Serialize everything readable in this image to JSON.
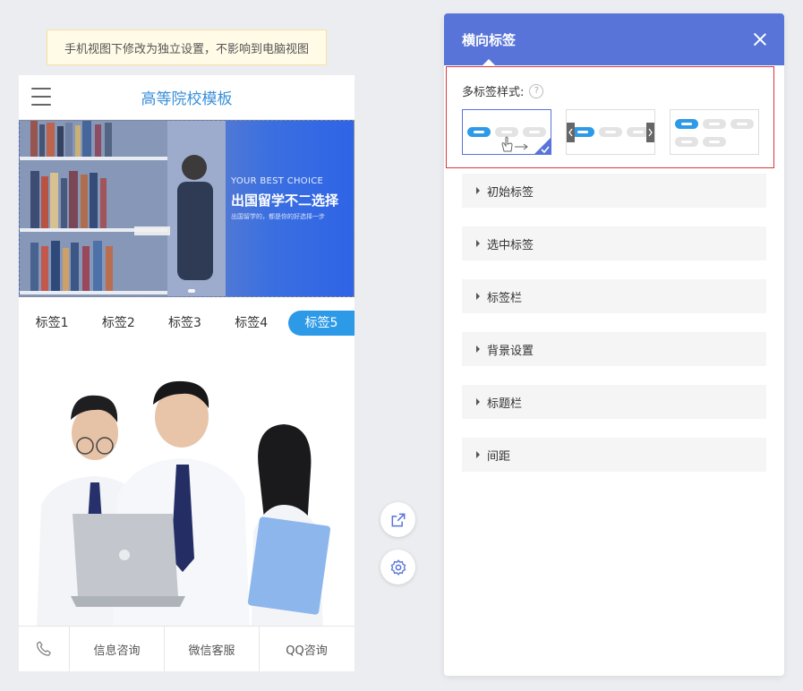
{
  "notice": "手机视图下修改为独立设置，不影响到电脑视图",
  "phone": {
    "title": "高等院校模板",
    "banner": {
      "eng": "YOUR BEST CHOICE",
      "big": "出国留学不二选择",
      "small": "出国留学的，都是你的好选择一步"
    },
    "tabs": [
      "标签1",
      "标签2",
      "标签3",
      "标签4",
      "标签5"
    ],
    "active_tab_index": 4,
    "footer": [
      "信息咨询",
      "微信客服",
      "QQ咨询"
    ]
  },
  "panel": {
    "title": "横向标签",
    "style_label": "多标签样式:",
    "help_glyph": "?",
    "selected_option_index": 0,
    "sections": [
      "初始标签",
      "选中标签",
      "标签栏",
      "背景设置",
      "标题栏",
      "间距"
    ]
  },
  "colors": {
    "accent": "#5874d8",
    "tab_active": "#2d9ae8",
    "title_blue": "#3a8fd9",
    "highlight_border": "#d9363e"
  }
}
